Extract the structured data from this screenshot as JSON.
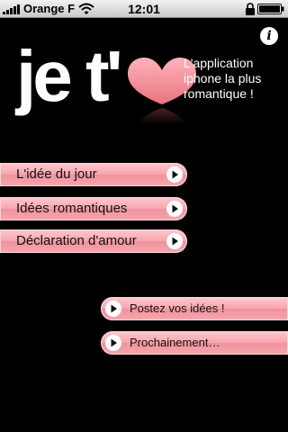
{
  "status_bar": {
    "carrier": "Orange F",
    "time": "12:01"
  },
  "logo": {
    "text": "je t'"
  },
  "tagline": "L'application iphone la plus romantique !",
  "menu": {
    "items": [
      {
        "label": "L'idée du jour"
      },
      {
        "label": "Idées romantiques"
      },
      {
        "label": "Déclaration d'amour"
      }
    ]
  },
  "side": {
    "items": [
      {
        "label": "Postez vos idées !"
      },
      {
        "label": "Prochainement…"
      }
    ]
  },
  "colors": {
    "background": "#000000",
    "button_pink": "#f7a4ad",
    "heart": "#f08c95"
  },
  "icons": {
    "info": "info-icon",
    "play": "play-icon",
    "heart": "heart-icon"
  }
}
